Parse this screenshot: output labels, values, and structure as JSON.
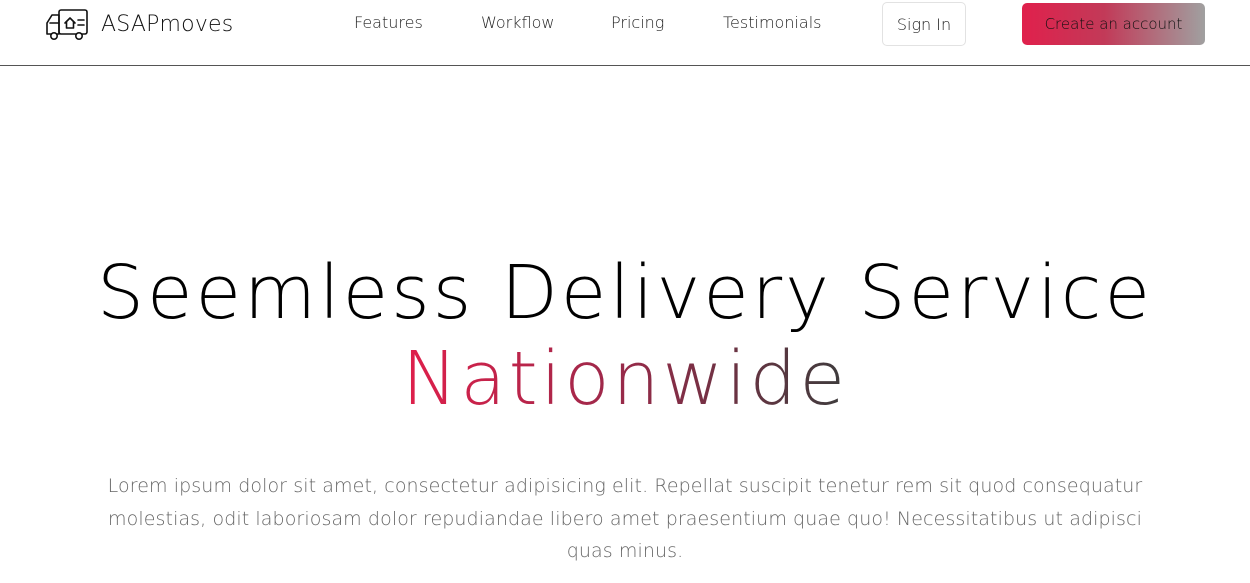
{
  "brand": {
    "name": "ASAPmoves",
    "icon": "moving-truck-icon"
  },
  "nav": {
    "links": [
      "Features",
      "Workflow",
      "Pricing",
      "Testimonials"
    ],
    "signin_label": "Sign In",
    "create_label": "Create an account"
  },
  "hero": {
    "headline": "Seemless Delivery Service",
    "headline_accent": "Nationwide",
    "lead": "Lorem ipsum dolor sit amet, consectetur adipisicing elit. Repellat suscipit tenetur rem sit quod consequatur molestias, odit laboriosam dolor repudiandae libero amet praesentium quae quo! Necessitatibus ut adipisci quas minus."
  },
  "colors": {
    "accent_start": "#e01f4b",
    "accent_end": "#3c3c3c",
    "button_gradient_end": "#a0a0a0",
    "lead_text": "#666666"
  }
}
